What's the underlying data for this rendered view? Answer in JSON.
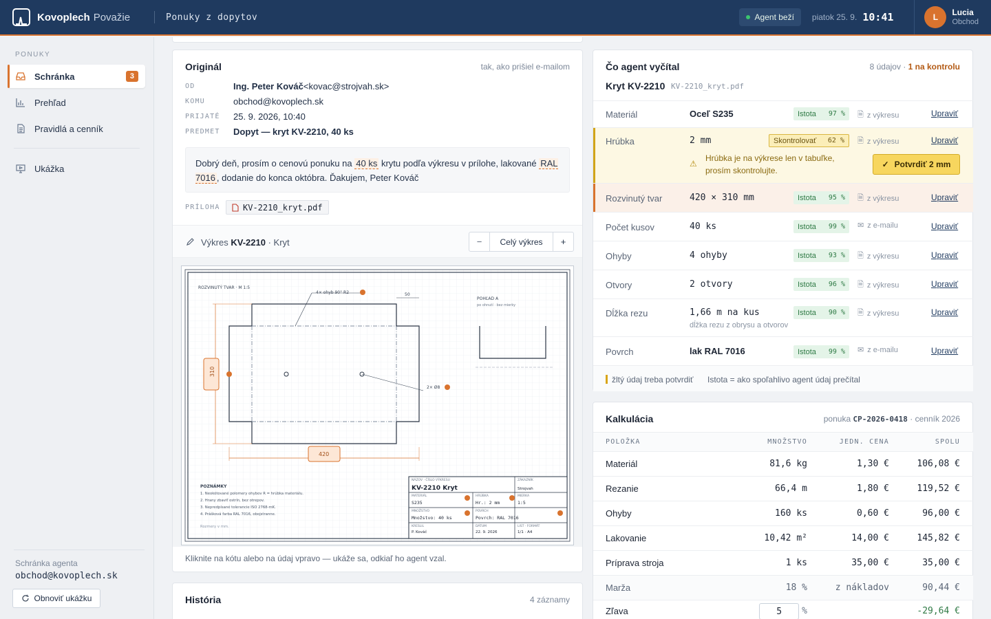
{
  "brand": {
    "name_bold": "Kovoplech",
    "name_light": "Považie"
  },
  "header": {
    "breadcrumb": "Ponuky z dopytov",
    "agent_status": "Agent beží",
    "date": "piatok 25. 9.",
    "time": "10:41",
    "user": {
      "initial": "L",
      "name": "Lucia",
      "role": "Obchod"
    }
  },
  "sidebar": {
    "section": "PONUKY",
    "items": [
      {
        "label": "Schránka",
        "badge": "3",
        "icon": "inbox-icon",
        "active": true
      },
      {
        "label": "Prehľad",
        "icon": "bar-chart-icon"
      },
      {
        "label": "Pravidlá a cenník",
        "icon": "document-icon"
      },
      {
        "label": "Ukážka",
        "icon": "monitor-icon"
      }
    ],
    "mailbox_label": "Schránka agenta",
    "mailbox_value": "obchod@kovoplech.sk",
    "refresh_label": "Obnoviť ukážku"
  },
  "original": {
    "title": "Originál",
    "subtitle": "tak, ako prišiel e-mailom",
    "fields": [
      {
        "label": "OD",
        "value": "Ing. Peter Kováč",
        "extra": " <kovac@strojvah.sk>"
      },
      {
        "label": "KOMU",
        "value": "obchod@kovoplech.sk"
      },
      {
        "label": "PRIJATÉ",
        "value": "25. 9. 2026, 10:40"
      },
      {
        "label": "PREDMET",
        "value": "Dopyt — kryt KV-2210, 40 ks"
      }
    ],
    "body": {
      "p1": "Dobrý deň, prosím o cenovú ponuku na ",
      "hl1": "40 ks",
      "p2": " krytu podľa výkresu v prílohe, lakované ",
      "hl2": "RAL 7016",
      "p3": ", dodanie do konca októbra. Ďakujem, Peter Kováč"
    },
    "attachment_label": "PRÍLOHA",
    "attachment": "KV-2210_kryt.pdf"
  },
  "drawing": {
    "label": "Výkres",
    "code": "KV-2210",
    "name": "· Kryt",
    "zoom_out": "−",
    "zoom_label": "Celý výkres",
    "zoom_in": "+",
    "footer": "Kliknite na kótu alebo na údaj vpravo — ukáže sa, odkiaľ ho agent vzal.",
    "sheet": {
      "title": "ROZVINUTÝ TVAR · M 1:5",
      "bend_note": "4× ohyb 90° R2",
      "dim_50": "50",
      "view_title": "POHĽAD A",
      "view_sub": "po ohnutí · bez mierky",
      "hole_note": "2× Ø8",
      "dim_310": "310",
      "dim_420": "420",
      "notes_title": "POZNÁMKY",
      "notes": [
        "1. Neokótované polomery ohybov R = hrúbka materiálu.",
        "2. Hrany zbaviť ostrín, bez otrepov.",
        "3. Nepredpísané tolerancie ISO 2768-mK.",
        "4. Prášková farba RAL 7016, obojstranne."
      ],
      "dims_unit": "Rozmery v mm.",
      "tb": {
        "name_lab": "NÁZOV · ČÍSLO VÝKRESU",
        "name": "KV-2210 Kryt",
        "cust_lab": "ZÁKAZNÍK",
        "cust": "Strojvah",
        "mat_lab": "MATERIÁL",
        "mat": "S235",
        "thk_lab": "HRÚBKA",
        "thk": "Hr.: 2 mm",
        "scale_lab": "MIERKA",
        "scale": "1:5",
        "qty_lab": "MNOŽSTVO",
        "qty": "Množstvo: 40 ks",
        "surf_lab": "POVRCH",
        "surf": "Povrch: RAL 7016",
        "drawn_lab": "KRESLIL",
        "drawn": "P. Kováč",
        "date_lab": "DÁTUM",
        "date": "22. 9. 2026",
        "sheet_lab": "LIST · FORMÁT",
        "sheet": "1/1 · A4"
      }
    }
  },
  "history": {
    "title": "História",
    "count": "4 záznamy"
  },
  "extracted": {
    "title": "Čo agent vyčítal",
    "count": "8 údajov · ",
    "review": "1 na kontrolu",
    "part": "Kryt KV-2210",
    "file": "KV-2210_kryt.pdf",
    "confidence_word": "Istota",
    "check_word": "Skontrolovať",
    "edit_label": "Upraviť",
    "rows": [
      {
        "label": "Materiál",
        "value": "Oceľ S235",
        "conf": "97 %",
        "source": "z výkresu"
      },
      {
        "label": "Hrúbka",
        "value": "2 mm",
        "conf": "62 %",
        "source": "z výkresu",
        "warning": "Hrúbka je na výkrese len v tabuľke, prosím skontrolujte.",
        "confirm": "Potvrdiť 2 mm"
      },
      {
        "label": "Rozvinutý tvar",
        "value": "420 × 310 mm",
        "conf": "95 %",
        "source": "z výkresu"
      },
      {
        "label": "Počet kusov",
        "value": "40 ks",
        "conf": "99 %",
        "source": "z e-mailu"
      },
      {
        "label": "Ohyby",
        "value": "4 ohyby",
        "conf": "93 %",
        "source": "z výkresu"
      },
      {
        "label": "Otvory",
        "value": "2 otvory",
        "conf": "96 %",
        "source": "z výkresu"
      },
      {
        "label": "Dĺžka rezu",
        "value": "1,66 m na kus",
        "sub": "dĺžka rezu z obrysu a otvorov",
        "conf": "90 %",
        "source": "z výkresu"
      },
      {
        "label": "Povrch",
        "value": "lak RAL 7016",
        "conf": "99 %",
        "source": "z e-mailu"
      }
    ],
    "legend_yellow": "žltý údaj treba potvrdiť",
    "legend_conf": "Istota = ako spoľahlivo agent údaj prečítal"
  },
  "calc": {
    "title": "Kalkulácia",
    "offer_prefix": "ponuka ",
    "offer": "CP-2026-0418",
    "offer_suffix": " · cenník 2026",
    "cols": [
      "POLOŽKA",
      "MNOŽSTVO",
      "JEDN. CENA",
      "SPOLU"
    ],
    "rows": [
      [
        "Materiál",
        "81,6 kg",
        "1,30 €",
        "106,08 €"
      ],
      [
        "Rezanie",
        "66,4 m",
        "1,80 €",
        "119,52 €"
      ],
      [
        "Ohyby",
        "160 ks",
        "0,60 €",
        "96,00 €"
      ],
      [
        "Lakovanie",
        "10,42 m²",
        "14,00 €",
        "145,82 €"
      ],
      [
        "Príprava stroja",
        "1 ks",
        "35,00 €",
        "35,00 €"
      ]
    ],
    "margin": {
      "label": "Marža",
      "qty": "18 %",
      "unit": "z nákladov",
      "total": "90,44 €"
    },
    "discount": {
      "label": "Zľava",
      "value": "5",
      "unit": "%",
      "total": "-29,64 €"
    }
  },
  "colors": {
    "accent": "#d9732e",
    "header": "#1f3a5f",
    "ok": "#2f7a45",
    "warn": "#f2d15a"
  }
}
